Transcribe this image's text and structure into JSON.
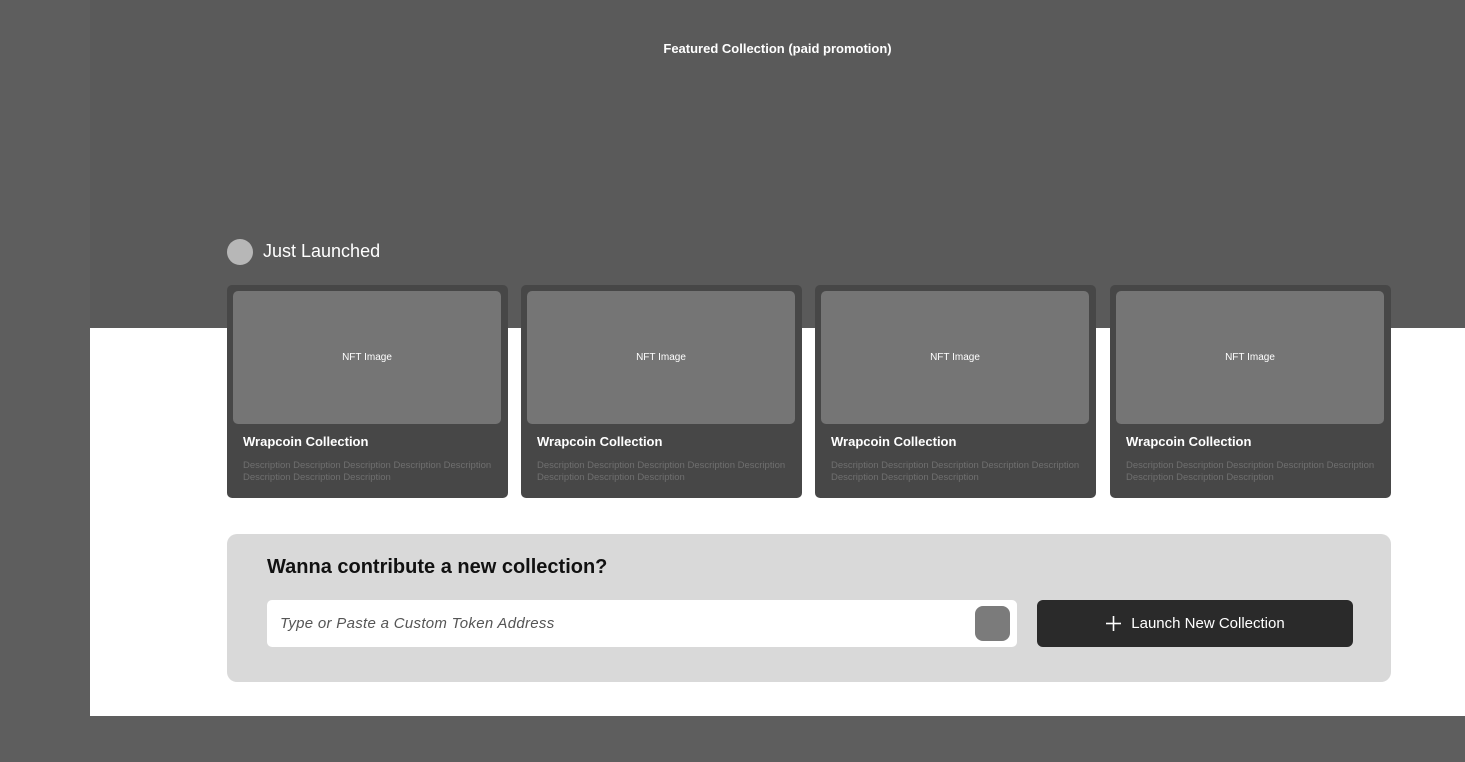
{
  "hero": {
    "title": "Featured Collection (paid promotion)"
  },
  "just_launched": {
    "title": "Just Launched",
    "cards": [
      {
        "image_label": "NFT Image",
        "title": "Wrapcoin Collection",
        "description": "Description Description Description Description Description Description Description Description"
      },
      {
        "image_label": "NFT Image",
        "title": "Wrapcoin Collection",
        "description": "Description Description Description Description Description Description Description Description"
      },
      {
        "image_label": "NFT Image",
        "title": "Wrapcoin Collection",
        "description": "Description Description Description Description Description Description Description Description"
      },
      {
        "image_label": "NFT Image",
        "title": "Wrapcoin Collection",
        "description": "Description Description Description Description Description Description Description Description"
      }
    ]
  },
  "contribute": {
    "title": "Wanna contribute a new collection?",
    "input_placeholder": "Type or Paste a Custom Token Address",
    "input_value": "",
    "launch_label": "Launch New Collection",
    "launch_icon": "plus-icon"
  },
  "colors": {
    "hero_bg": "#5a5a5a",
    "card_bg": "#474747",
    "card_image_bg": "#757575",
    "panel_bg": "#d9d9d9",
    "button_bg": "#2a2a2a"
  }
}
